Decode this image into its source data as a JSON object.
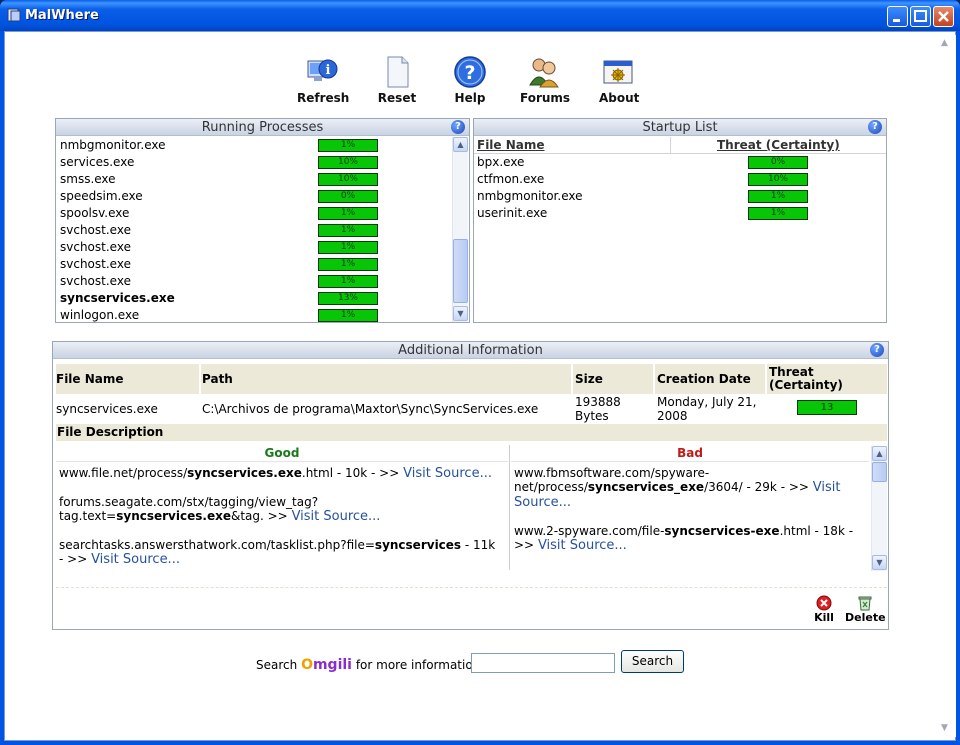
{
  "window": {
    "title": "MalWhere"
  },
  "toolbar": [
    {
      "label": "Refresh",
      "icon": "refresh-icon"
    },
    {
      "label": "Reset",
      "icon": "reset-icon"
    },
    {
      "label": "Help",
      "icon": "help-icon"
    },
    {
      "label": "Forums",
      "icon": "forums-icon"
    },
    {
      "label": "About",
      "icon": "about-icon"
    }
  ],
  "running_processes": {
    "title": "Running Processes",
    "items": [
      {
        "name": "nmbgmonitor.exe",
        "threat": "1%",
        "bold": false
      },
      {
        "name": "services.exe",
        "threat": "10%",
        "bold": false
      },
      {
        "name": "smss.exe",
        "threat": "10%",
        "bold": false
      },
      {
        "name": "speedsim.exe",
        "threat": "0%",
        "bold": false
      },
      {
        "name": "spoolsv.exe",
        "threat": "1%",
        "bold": false
      },
      {
        "name": "svchost.exe",
        "threat": "1%",
        "bold": false
      },
      {
        "name": "svchost.exe",
        "threat": "1%",
        "bold": false
      },
      {
        "name": "svchost.exe",
        "threat": "1%",
        "bold": false
      },
      {
        "name": "svchost.exe",
        "threat": "1%",
        "bold": false
      },
      {
        "name": "syncservices.exe",
        "threat": "13%",
        "bold": true
      },
      {
        "name": "winlogon.exe",
        "threat": "1%",
        "bold": false
      }
    ]
  },
  "startup_list": {
    "title": "Startup List",
    "col_file": "File Name",
    "col_threat": "Threat (Certainty)",
    "items": [
      {
        "name": "bpx.exe",
        "threat": "0%"
      },
      {
        "name": "ctfmon.exe",
        "threat": "10%"
      },
      {
        "name": "nmbgmonitor.exe",
        "threat": "1%"
      },
      {
        "name": "userinit.exe",
        "threat": "1%"
      }
    ]
  },
  "additional": {
    "title": "Additional Information",
    "headers": {
      "file_name": "File Name",
      "path": "Path",
      "size": "Size",
      "creation_date": "Creation Date",
      "threat": "Threat (Certainty)"
    },
    "row": {
      "file_name": "syncservices.exe",
      "path": "C:\\Archivos de programa\\Maxtor\\Sync\\SyncServices.exe",
      "size": "193888 Bytes",
      "creation_date": "Monday, July 21, 2008",
      "threat": "13"
    },
    "file_description_label": "File Description",
    "good_label": "Good",
    "bad_label": "Bad",
    "good": [
      {
        "pre": "www.file.net/process/",
        "bold": "syncservices.exe",
        "post": ".html - 10k - >>",
        "link": "Visit Source..."
      },
      {
        "pre": "forums.seagate.com/stx/tagging/view_tag?tag.text=",
        "bold": "syncservices.exe",
        "post": "&tag. >>",
        "link": "Visit Source..."
      },
      {
        "pre": "searchtasks.answersthatwork.com/tasklist.php?file=",
        "bold": "syncservices",
        "post": " - 11k - >>",
        "link": "Visit Source..."
      }
    ],
    "bad": [
      {
        "pre": "www.fbmsoftware.com/spyware-net/process/",
        "bold": "syncservices_exe",
        "post": "/3604/ - 29k - >>",
        "link": "Visit Source..."
      },
      {
        "pre": "www.2-spyware.com/file-",
        "bold": "syncservices-exe",
        "post": ".html - 18k - >>",
        "link": "Visit Source..."
      }
    ],
    "kill_label": "Kill",
    "delete_label": "Delete"
  },
  "search": {
    "prefix": "Search",
    "brand": "Omgili",
    "suffix": "for more information",
    "button": "Search",
    "value": ""
  },
  "colors": {
    "bar_green": "#06c606",
    "good": "#1a7a1a",
    "bad": "#c01b1b",
    "link": "#2550a0",
    "omgili_o": "#f0a000",
    "omgili_rest": "#8b2bd0"
  }
}
